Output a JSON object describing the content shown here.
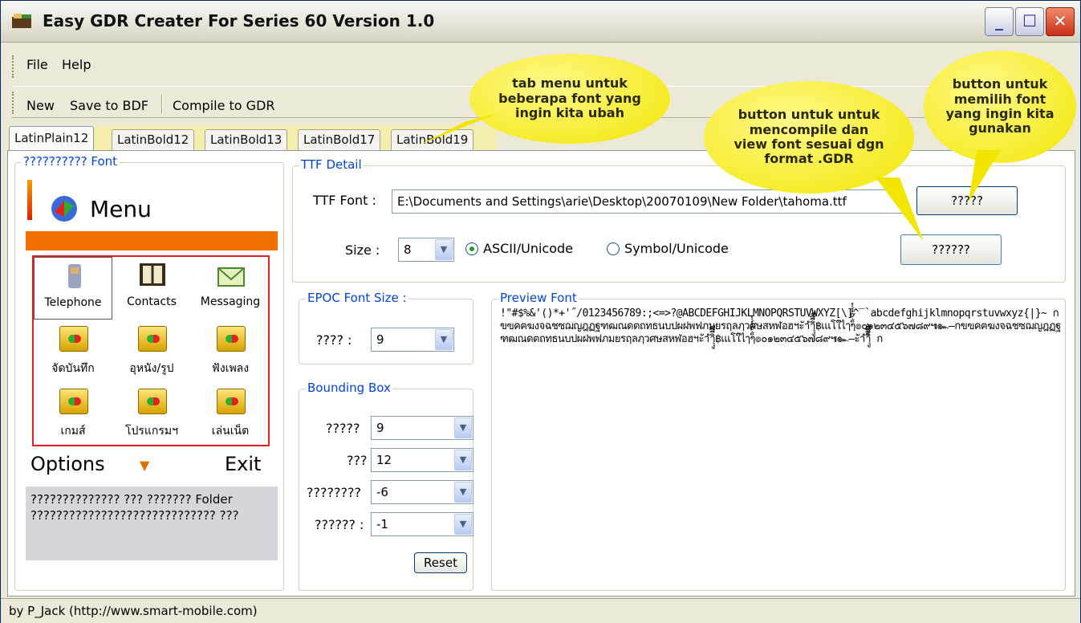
{
  "window": {
    "title": "Easy GDR Creater For Series 60 Version 1.0"
  },
  "menu": {
    "file": "File",
    "help": "Help"
  },
  "toolbar": {
    "new": "New",
    "save_bdf": "Save to BDF",
    "compile": "Compile to GDR"
  },
  "tabs": [
    "LatinPlain12",
    "LatinBold12",
    "LatinBold13",
    "LatinBold17",
    "LatinBold19"
  ],
  "font_group": {
    "label": "?????????? Font",
    "menu_title": "Menu",
    "apps": [
      "Telephone",
      "Contacts",
      "Messaging",
      "จัดบันทึก",
      "อุหนัง/รูป",
      "ฟังเพลง",
      "เกมส์",
      "โปรแกรมฯ",
      "เล่นเน็ต"
    ],
    "options": "Options",
    "exit": "Exit",
    "info_text": "?????????????? ??? ??????? Folder ????????????????????????????? ???"
  },
  "ttf": {
    "label": "TTF Detail",
    "font_label": "TTF Font :",
    "font_path": "E:\\Documents and Settings\\arie\\Desktop\\20070109\\New Folder\\tahoma.ttf",
    "browse_btn": "?????",
    "size_label": "Size :",
    "size_value": "8",
    "radio_ascii": "ASCII/Unicode",
    "radio_symbol": "Symbol/Unicode",
    "compile_btn": "??????"
  },
  "epoc": {
    "label": "EPOC Font Size :",
    "field_label": "???? :",
    "value": "9"
  },
  "bbox": {
    "label": "Bounding Box",
    "rows": [
      {
        "label": "?????",
        "value": "9"
      },
      {
        "label": "???",
        "value": "12"
      },
      {
        "label": "????????",
        "value": "-6"
      },
      {
        "label": "?????? :",
        "value": "-1"
      }
    ],
    "reset": "Reset"
  },
  "preview": {
    "label": "Preview Font",
    "text": "!\"#$%&'()*+'˝/0123456789:;<=>?@ABCDEFGHIJKLMNOPQRSTUVWXYZ[\\]^‾`abcdefghijklmnopqrstuvwxyz{|}~ กขฃคฅฆงจฉชซฌญฎฏฐฑฒณดตถทธนบปผฝพฟภมยรฤลฦวศษสหฬอฮฯะัาำิีึืฺุู฿เแโใไๅๆ็่้๊๋์ํ๎๏๐๑๒๓๔๕๖๗๘๙๚๛–กขฃคฅฆงจฉชซฌญฎฏฐฑฒณดตถทธนบปผฝพฟภมยรฤลฦวศษสหฬอฮฯะัาำิีึืฺุู฿เแโใไๅๆ็่้๊๋์ํ๎๏๐๑๒๓๔๕๖๗๘๙๚๛–ะัาำิีึืุู็่้๊๋ ก"
  },
  "status": "by P_Jack (http://www.smart-mobile.com)",
  "annotations": {
    "tabs_note": "tab menu untuk beberapa font yang ingin kita ubah",
    "compile_note": "button untuk untuk mencompile dan view font sesuai dgn format .GDR",
    "browse_note": "button untuk memilih font yang ingin kita gunakan"
  }
}
